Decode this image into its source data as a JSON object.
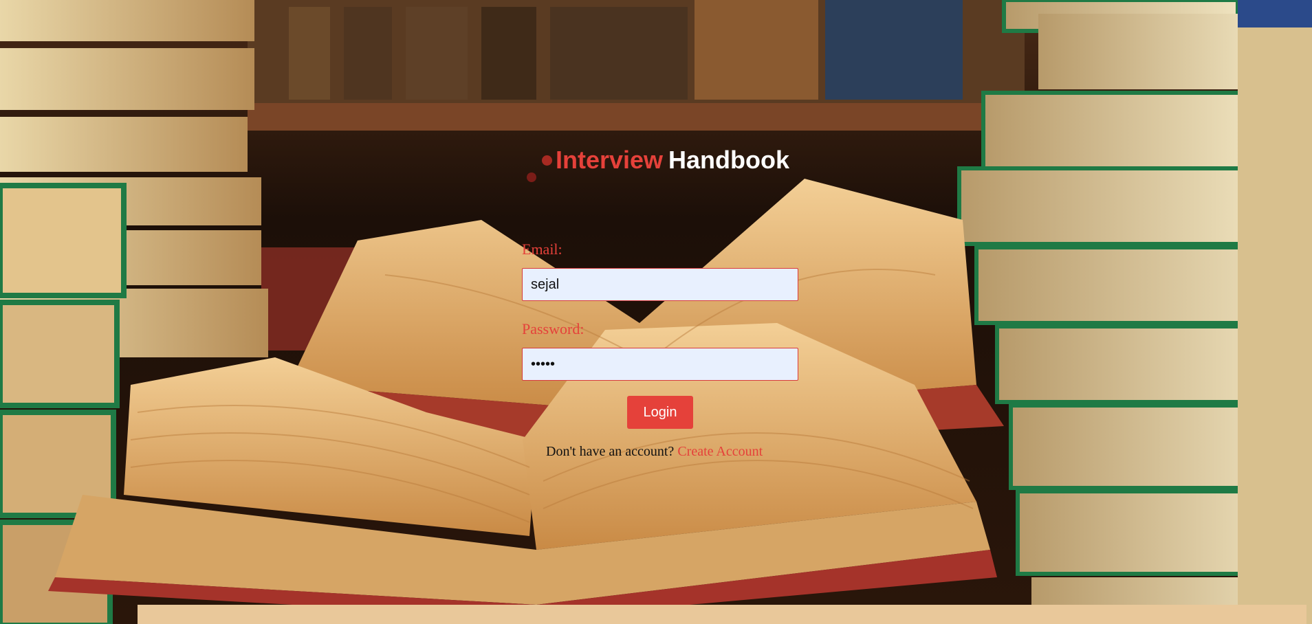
{
  "brand": {
    "word1": "Interview",
    "word2": "Handbook"
  },
  "login_form": {
    "email_label": "Email:",
    "email_value": "sejal",
    "password_label": "Password:",
    "password_value": "•••••",
    "login_button": "Login",
    "signup_prompt": "Don't have an account?",
    "signup_link": "Create Account"
  },
  "colors": {
    "accent": "#e5413a",
    "input_background": "#e8f0fe",
    "brand_secondary": "#ffffff"
  },
  "background": {
    "subject": "books-library-photo"
  }
}
